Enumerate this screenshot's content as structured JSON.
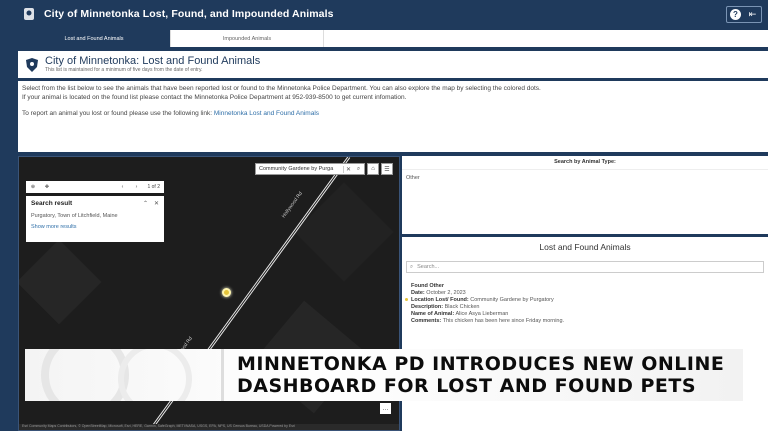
{
  "header": {
    "title": "City of Minnetonka Lost, Found, and Impounded Animals",
    "help_icon": "?",
    "collapse_icon": "⇤"
  },
  "tabs": [
    {
      "label": "Lost and Found Animals",
      "active": true
    },
    {
      "label": "Impounded Animals",
      "active": false
    }
  ],
  "title_panel": {
    "title": "City of Minnetonka: Lost and Found Animals",
    "subtitle": "This list is maintained for a minimum of five days from the date of entry."
  },
  "info": {
    "line1": "Select from the list below to see the animals that have been reported lost or found to the Minnetonka Police Department. You can also explore the map by selecting the colored dots.",
    "line2": "If your animal is located on the found list please contact the Minnetonka Police Department at 952-939-8500 to get current infomation.",
    "line3_prefix": "To report an animal you lost or found please use the following link: ",
    "line3_link": "Minnetonka Lost and Found Animals"
  },
  "map": {
    "search_value": "Community Gardene by Purga",
    "clear_icon": "✕",
    "search_icon": "⌕",
    "home_icon": "⌂",
    "list_icon": "☰",
    "zoom_icon": "⊕",
    "pan_icon": "✥",
    "prev_icon": "‹",
    "next_icon": "›",
    "pager": "1 of 2",
    "popup": {
      "title": "Search result",
      "collapse": "⌃",
      "close": "✕",
      "body": "Purgatory, Town of Litchfield, Maine",
      "link": "Show more results"
    },
    "road_label_1": "Hollywood Rd",
    "road_label_2": "Hollywood Rd",
    "more_icon": "…",
    "attribution": "Esri Community Maps Contributors, © OpenStreetMap, Microsoft, Esri, HERE, Garmin, SafeGraph, METI/NASA, USGS, EPA, NPS, US Census Bureau, USDA    Powered by Esri"
  },
  "search_type": {
    "title": "Search by Animal Type:",
    "option": "Other"
  },
  "lost_found": {
    "title": "Lost and Found Animals",
    "search_placeholder": "Search...",
    "search_icon": "⌕",
    "entry": {
      "status": "Found Other",
      "date_label": "Date:",
      "date": "October 2, 2023",
      "location_label": "Location Lost/ Found:",
      "location": "Community Gardene by Purgatory",
      "description_label": "Description:",
      "description": "Black Chicken",
      "name_label": "Name of Animal:",
      "name": "Alice Asya Lieberman",
      "comments_label": "Comments:",
      "comments": "This chicken has been here since Friday morning."
    }
  },
  "news": {
    "headline_line1": "MINNETONKA PD INTRODUCES NEW ONLINE",
    "headline_line2": "DASHBOARD FOR LOST AND FOUND PETS"
  }
}
